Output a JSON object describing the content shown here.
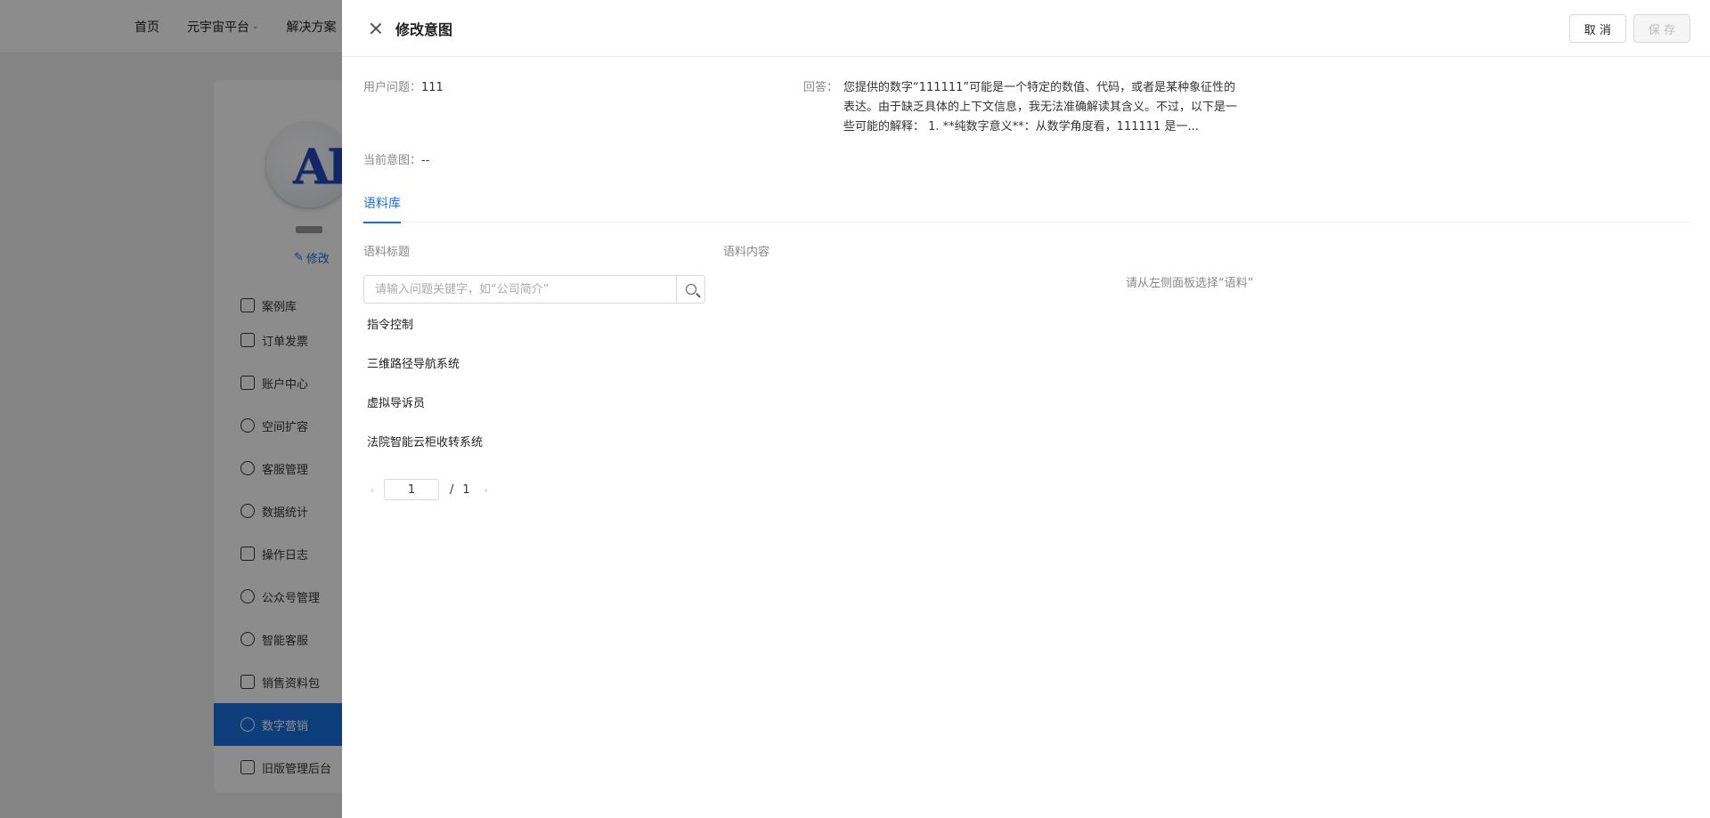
{
  "topnav": {
    "items": [
      {
        "label": "首页",
        "has_dropdown": false
      },
      {
        "label": "元宇宙平台",
        "has_dropdown": true
      },
      {
        "label": "解决方案",
        "has_dropdown": false
      }
    ]
  },
  "sidebar": {
    "edit_label": "修改",
    "items": [
      {
        "label": "案例库",
        "icon": "case-icon",
        "active": false
      },
      {
        "label": "订单发票",
        "icon": "invoice-icon",
        "active": false
      },
      {
        "label": "账户中心",
        "icon": "home-icon",
        "active": false
      },
      {
        "label": "空间扩容",
        "icon": "pie-icon",
        "active": false
      },
      {
        "label": "客服管理",
        "icon": "headset-icon",
        "active": false
      },
      {
        "label": "数据统计",
        "icon": "chart-icon",
        "active": false
      },
      {
        "label": "操作日志",
        "icon": "grid-icon",
        "active": false
      },
      {
        "label": "公众号管理",
        "icon": "wechat-icon",
        "active": false
      },
      {
        "label": "智能客服",
        "icon": "chat-icon",
        "active": false
      },
      {
        "label": "销售资料包",
        "icon": "books-icon",
        "active": false
      },
      {
        "label": "数字营销",
        "icon": "marketing-icon",
        "active": true
      },
      {
        "label": "旧版管理后台",
        "icon": "window-icon",
        "active": false
      }
    ]
  },
  "drawer": {
    "title": "修改意图",
    "cancel_label": "取 消",
    "save_label": "保 存",
    "question_label": "用户问题：",
    "question_value": "111",
    "answer_label": "回答：",
    "answer_value": "您提供的数字“111111”可能是一个特定的数值、代码，或者是某种象征性的表达。由于缺乏具体的上下文信息，我无法准确解读其含义。不过，以下是一些可能的解释： 1. **纯数字意义**：从数学角度看，111111 是一...",
    "intent_label": "当前意图：",
    "intent_value": "--",
    "tab_label": "语料库",
    "col_title_label": "语料标题",
    "col_content_label": "语料内容",
    "search_placeholder": "请输入问题关键字，如“公司简介”",
    "corpus_items": [
      "指令控制",
      "三维路径导航系统",
      "虚拟导诉员",
      "法院智能云柜收转系统"
    ],
    "pager": {
      "current": "1",
      "total": "1",
      "separator": "/"
    },
    "empty_hint": "请从左侧面板选择“语料”"
  },
  "colors": {
    "accent": "#1a6fe0",
    "overlay": "rgba(0,0,0,0.45)"
  }
}
